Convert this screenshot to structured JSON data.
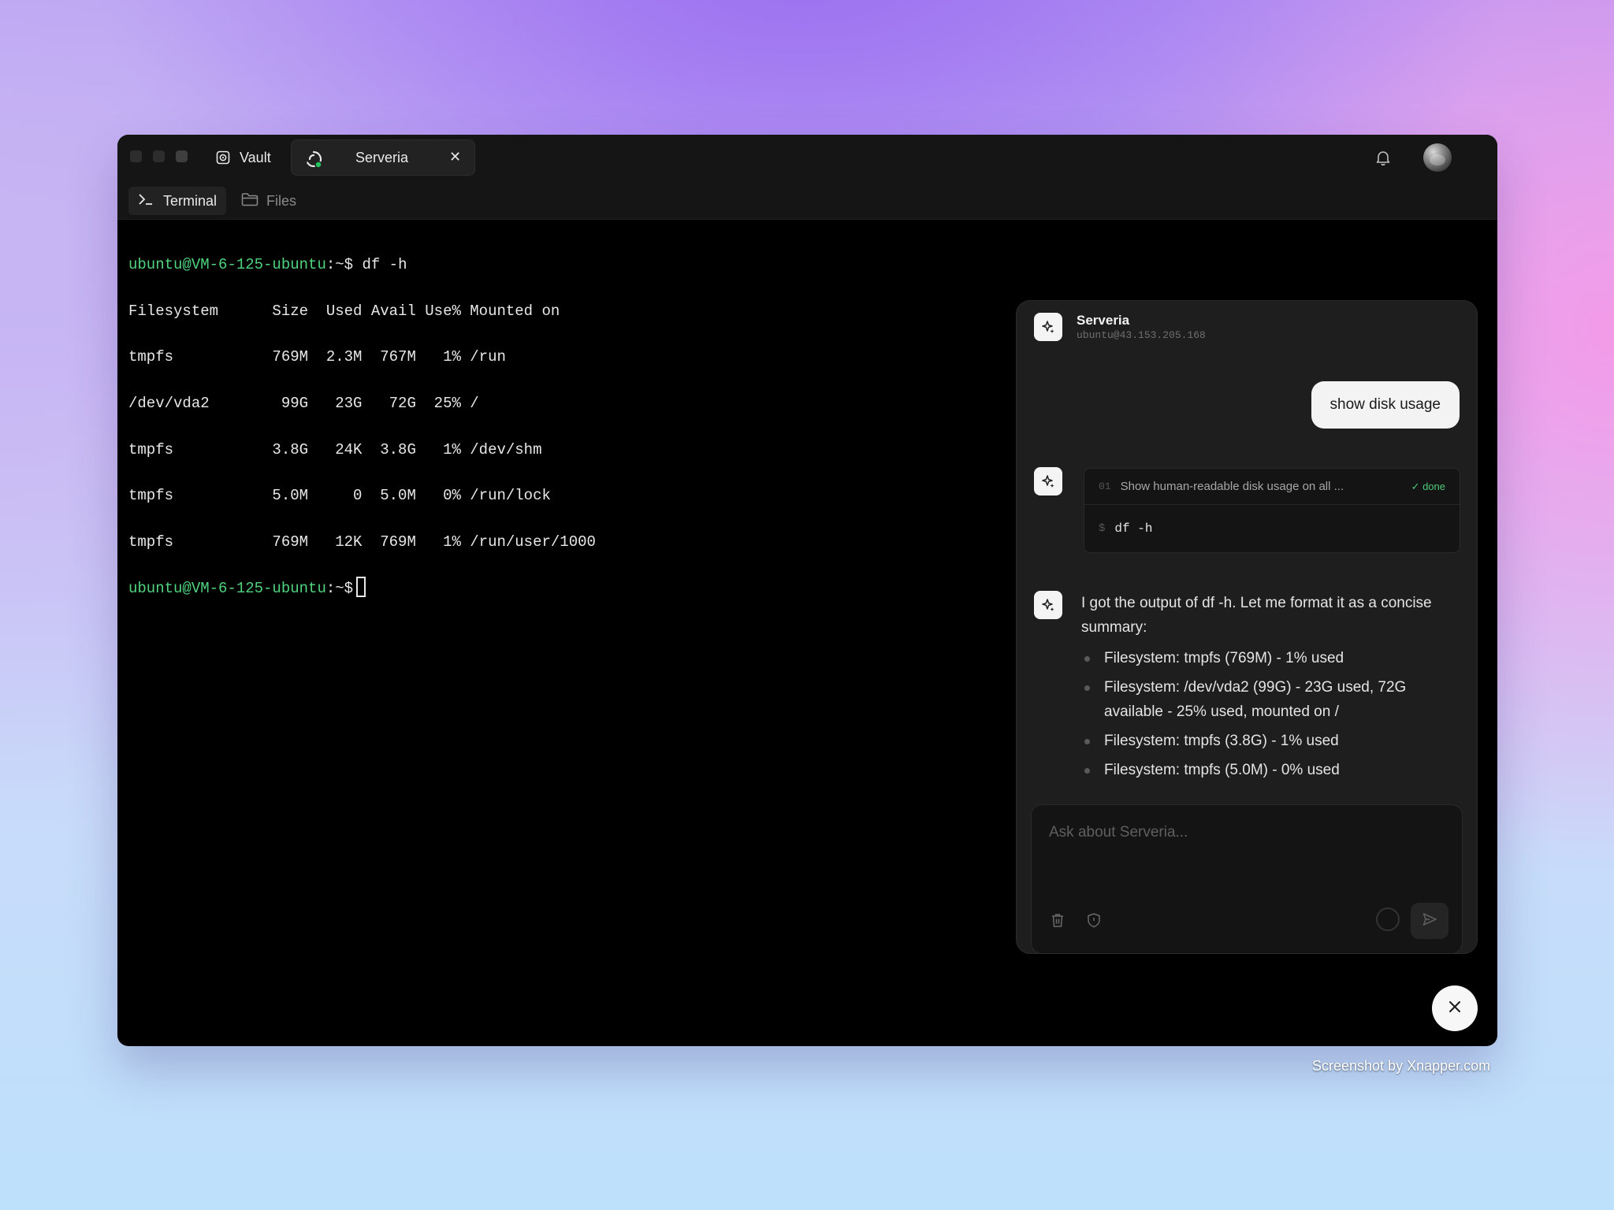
{
  "tabs": {
    "vault_label": "Vault",
    "serveria_label": "Serveria",
    "close_symbol": "✕"
  },
  "subtabs": {
    "terminal_label": "Terminal",
    "files_label": "Files"
  },
  "terminal": {
    "prompt_user": "ubuntu@VM-6-125-ubuntu",
    "prompt_suffix": ":~$",
    "command": " df -h",
    "header": "Filesystem      Size  Used Avail Use% Mounted on",
    "rows": [
      "tmpfs           769M  2.3M  767M   1% /run",
      "/dev/vda2        99G   23G   72G  25% /",
      "tmpfs           3.8G   24K  3.8G   1% /dev/shm",
      "tmpfs           5.0M     0  5.0M   0% /run/lock",
      "tmpfs           769M   12K  769M   1% /run/user/1000"
    ]
  },
  "chat": {
    "title": "Serveria",
    "subtitle": "ubuntu@43.153.205.168",
    "user_message": "show disk usage",
    "tool": {
      "number": "01",
      "description": "Show human-readable disk usage on all ...",
      "status": "✓ done",
      "dollar": "$",
      "command": "df -h"
    },
    "reply_intro": "I got the output of df -h. Let me format it as a concise summary:",
    "reply_items": [
      "Filesystem: tmpfs (769M) - 1% used",
      "Filesystem: /dev/vda2 (99G) - 23G used, 72G available - 25% used, mounted on /",
      "Filesystem: tmpfs (3.8G) - 1% used",
      "Filesystem: tmpfs (5.0M) - 0% used"
    ],
    "input_placeholder": "Ask about Serveria..."
  },
  "watermark": "Screenshot by Xnapper.com",
  "icons": {
    "vault": "vault-icon",
    "serveria": "serveria-icon",
    "bell": "bell-icon",
    "avatar": "avatar",
    "terminal": "terminal-icon",
    "folder": "folder-icon",
    "sparkle": "sparkle-icon",
    "trash": "trash-icon",
    "shield": "shield-icon",
    "send": "send-icon",
    "close": "close-icon"
  },
  "colors": {
    "prompt_green": "#4fd37e",
    "done_green": "#4fc77a",
    "status_dot": "#22c55e"
  }
}
